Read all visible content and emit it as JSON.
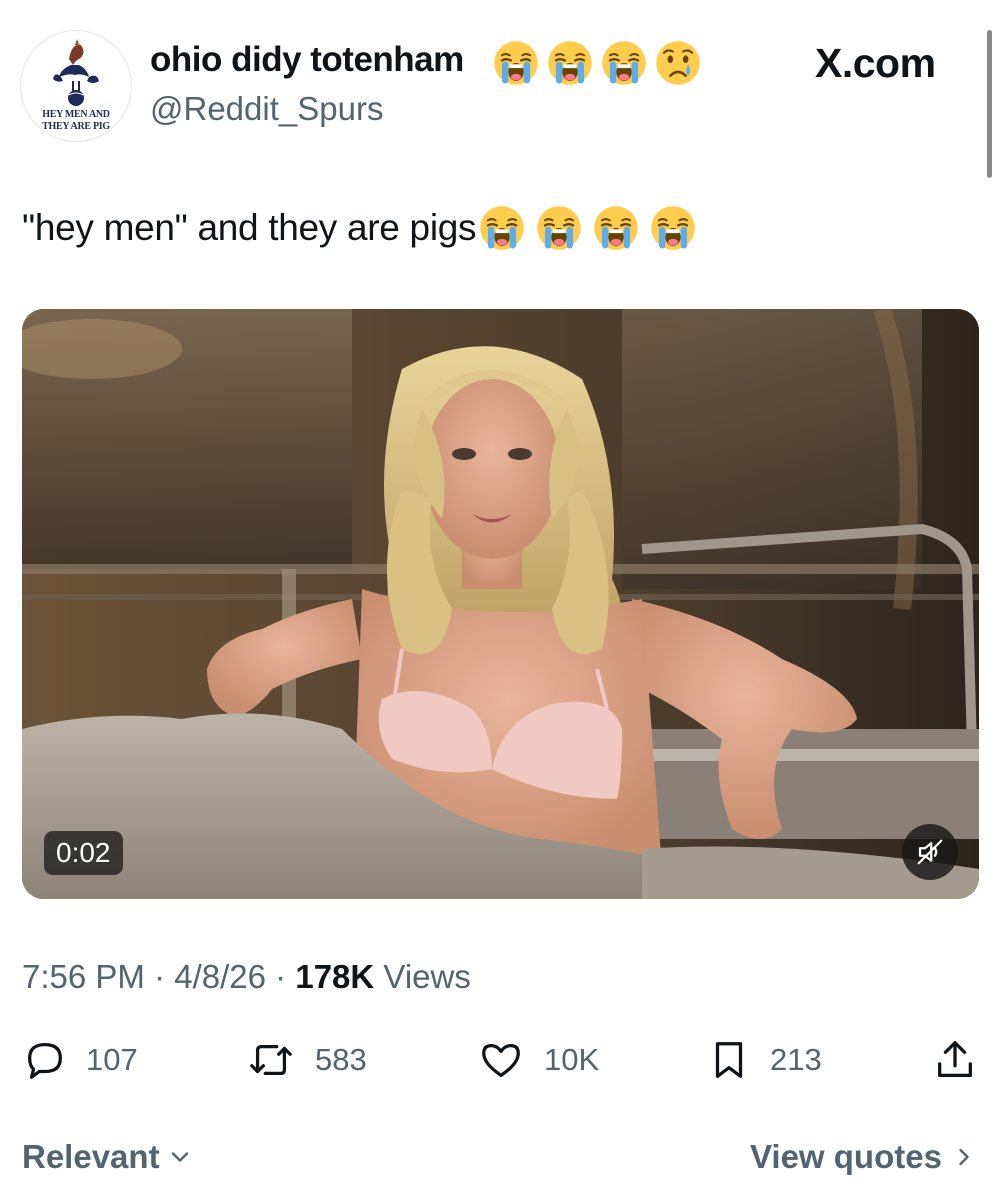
{
  "profile": {
    "display_name": "ohio didy totenham",
    "name_emojis": [
      "loudly-crying-face",
      "loudly-crying-face",
      "loudly-crying-face",
      "crying-face"
    ],
    "handle": "@Reddit_Spurs",
    "avatar": {
      "line1": "HEY MEN AND",
      "line2": "THEY ARE PIG",
      "icon": "cockerel-on-ball-crest-icon",
      "brand_color": "#1e2a5a"
    }
  },
  "source_label": "X.com",
  "tweet": {
    "text": "\"hey men\" and they are pigs",
    "text_emojis": [
      "loudly-crying-face",
      "loudly-crying-face",
      "loudly-crying-face",
      "loudly-crying-face"
    ]
  },
  "media": {
    "duration": "0:02",
    "mute_icon": "speaker-muted-icon",
    "scene": "woman in a bubble-filled steel tub"
  },
  "meta": {
    "time": "7:56 PM",
    "separator": "·",
    "date": "4/8/26",
    "views_count": "178K",
    "views_label": "Views"
  },
  "actions": {
    "reply": {
      "icon": "reply-icon",
      "count": "107"
    },
    "repost": {
      "icon": "repost-icon",
      "count": "583"
    },
    "like": {
      "icon": "heart-icon",
      "count": "10K"
    },
    "bookmark": {
      "icon": "bookmark-icon",
      "count": "213"
    },
    "share": {
      "icon": "share-icon"
    }
  },
  "footer": {
    "sort_label": "Relevant",
    "quotes_label": "View quotes"
  },
  "colors": {
    "text": "#0f1419",
    "muted": "#536471",
    "background": "#ffffff"
  }
}
